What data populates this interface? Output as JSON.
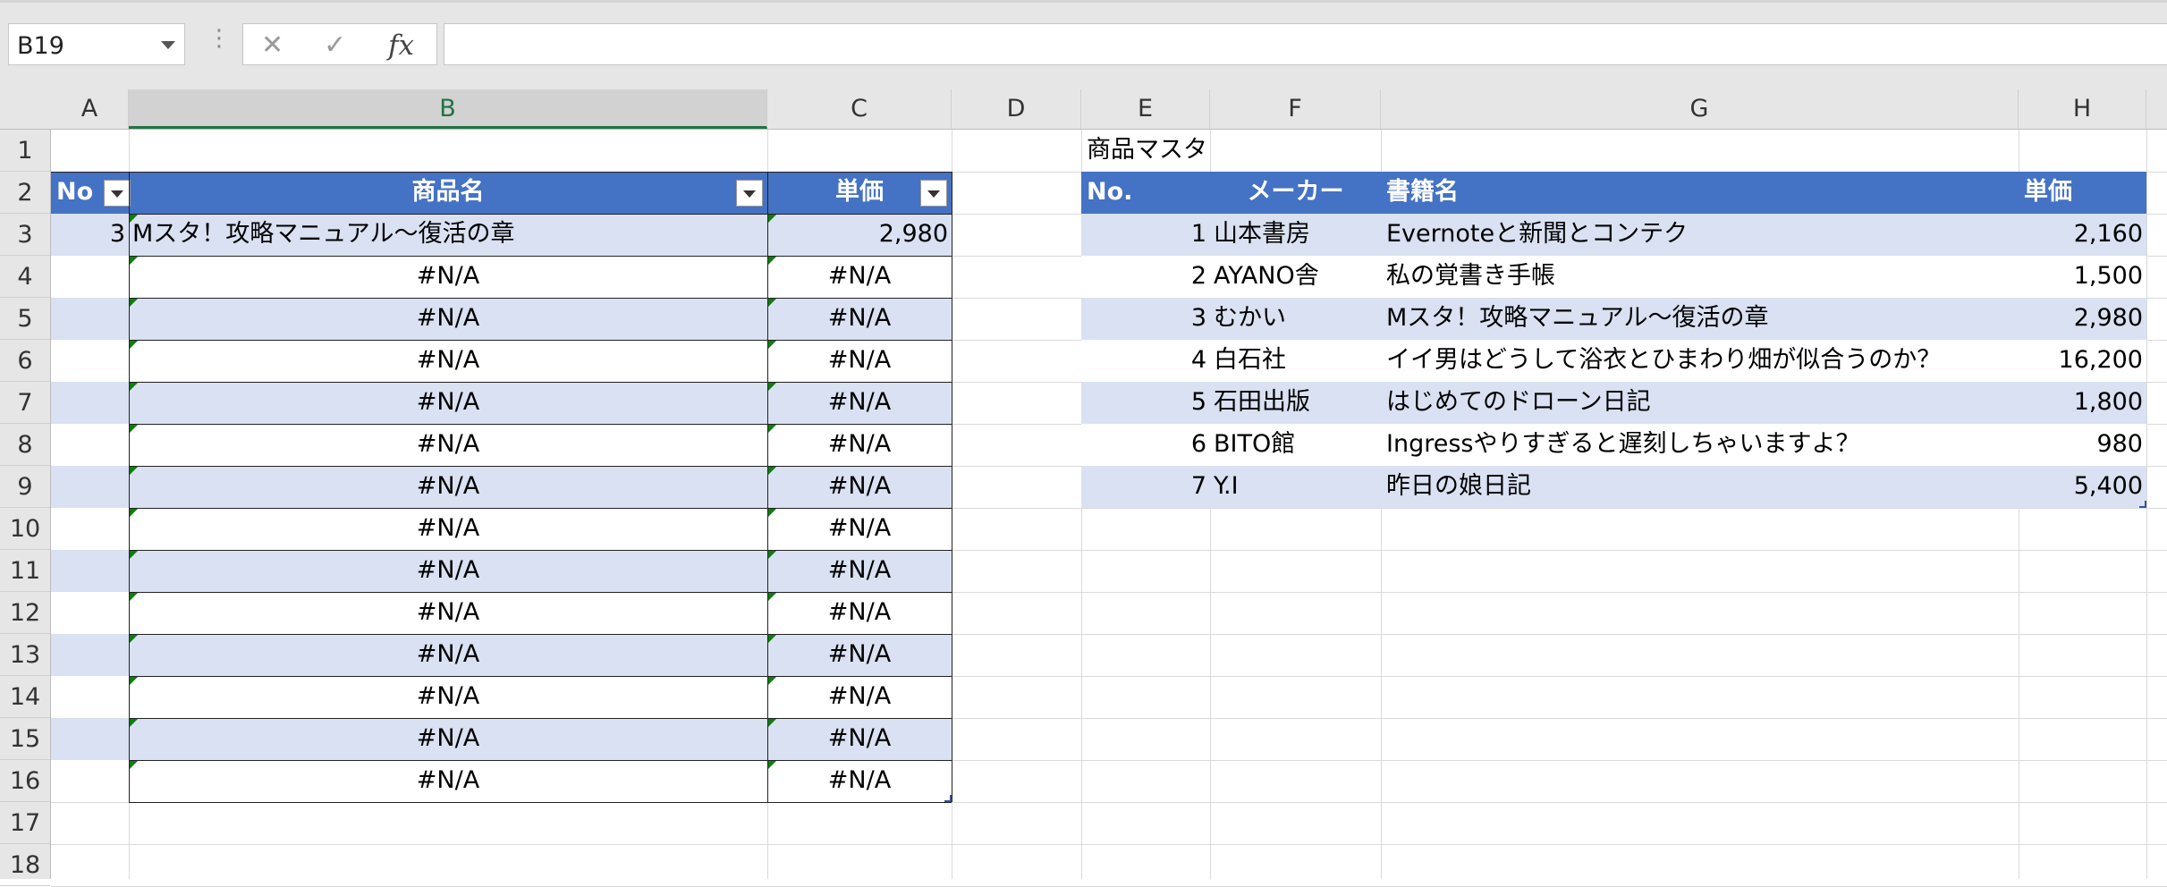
{
  "formula_bar": {
    "name_box": "B19",
    "more_glyph": "⋮",
    "cancel_glyph": "✕",
    "enter_glyph": "✓",
    "fx_label": "fx",
    "formula": ""
  },
  "columns": [
    "A",
    "B",
    "C",
    "D",
    "E",
    "F",
    "G",
    "H"
  ],
  "selected_column": "B",
  "rows": [
    "1",
    "2",
    "3",
    "4",
    "5",
    "6",
    "7",
    "8",
    "9",
    "10",
    "11",
    "12",
    "13",
    "14",
    "15",
    "16",
    "17",
    "18"
  ],
  "order_table": {
    "headers": {
      "no": "No",
      "name": "商品名",
      "price": "単価"
    },
    "first_row": {
      "no": "3",
      "name": "Mスタ！攻略マニュアル～復活の章",
      "price": "2,980"
    },
    "error_value": "#N/A"
  },
  "master": {
    "title": "商品マスタ",
    "headers": {
      "no": "No.",
      "maker": "メーカー",
      "book": "書籍名",
      "price": "単価"
    },
    "rows": [
      {
        "no": "1",
        "maker": "山本書房",
        "book": "Evernoteと新聞とコンテク",
        "price": "2,160"
      },
      {
        "no": "2",
        "maker": "AYANO舎",
        "book": "私の覚書き手帳",
        "price": "1,500"
      },
      {
        "no": "3",
        "maker": "むかい",
        "book": "Mスタ！攻略マニュアル～復活の章",
        "price": "2,980"
      },
      {
        "no": "4",
        "maker": "白石社",
        "book": "イイ男はどうして浴衣とひまわり畑が似合うのか？",
        "price": "16,200"
      },
      {
        "no": "5",
        "maker": "石田出版",
        "book": "はじめてのドローン日記",
        "price": "1,800"
      },
      {
        "no": "6",
        "maker": "BITO館",
        "book": "Ingressやりすぎると遅刻しちゃいますよ？",
        "price": "980"
      },
      {
        "no": "7",
        "maker": "Y.I",
        "book": "昨日の娘日記",
        "price": "5,400"
      }
    ]
  },
  "colors": {
    "header_blue": "#4472c4",
    "band_blue": "#d9e1f2",
    "excel_green": "#217346"
  }
}
